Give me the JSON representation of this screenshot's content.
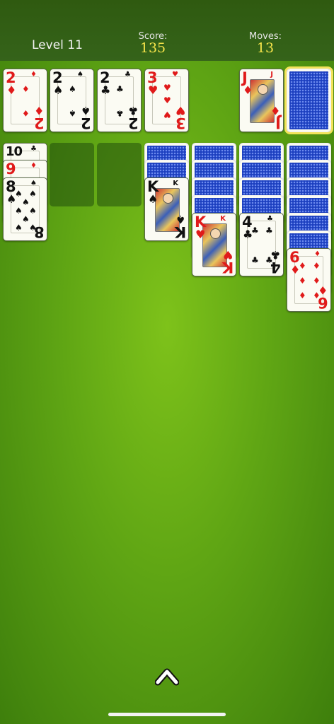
{
  "header": {
    "level": "Level 11",
    "score_label": "Score:",
    "score_value": "135",
    "moves_label": "Moves:",
    "moves_value": "13"
  },
  "foundations": [
    {
      "rank": "2",
      "suit": "♦",
      "color": "red"
    },
    {
      "rank": "2",
      "suit": "♠",
      "color": "black"
    },
    {
      "rank": "2",
      "suit": "♣",
      "color": "black"
    },
    {
      "rank": "3",
      "suit": "♥",
      "color": "red"
    }
  ],
  "waste": {
    "rank": "J",
    "suit": "♦",
    "color": "red"
  },
  "stock": {
    "icon": "card-back"
  },
  "tableau": {
    "col1": [
      {
        "rank": "10",
        "suit": "♣",
        "color": "black"
      },
      {
        "rank": "9",
        "suit": "♦",
        "color": "red"
      },
      {
        "rank": "8",
        "suit": "♠",
        "color": "black"
      }
    ],
    "col4": {
      "rank": "K",
      "suit": "♠",
      "color": "black"
    },
    "col5": {
      "rank": "K",
      "suit": "♥",
      "color": "red"
    },
    "col6": {
      "rank": "4",
      "suit": "♣",
      "color": "black"
    },
    "col7": {
      "rank": "6",
      "suit": "♦",
      "color": "red"
    }
  },
  "footer": {
    "menu_icon": "chevron-up-icon"
  },
  "colors": {
    "red_suit": "#e01a1a",
    "black_suit": "#111111",
    "score": "#f6e44a",
    "card_back": "#1c3fbf"
  }
}
